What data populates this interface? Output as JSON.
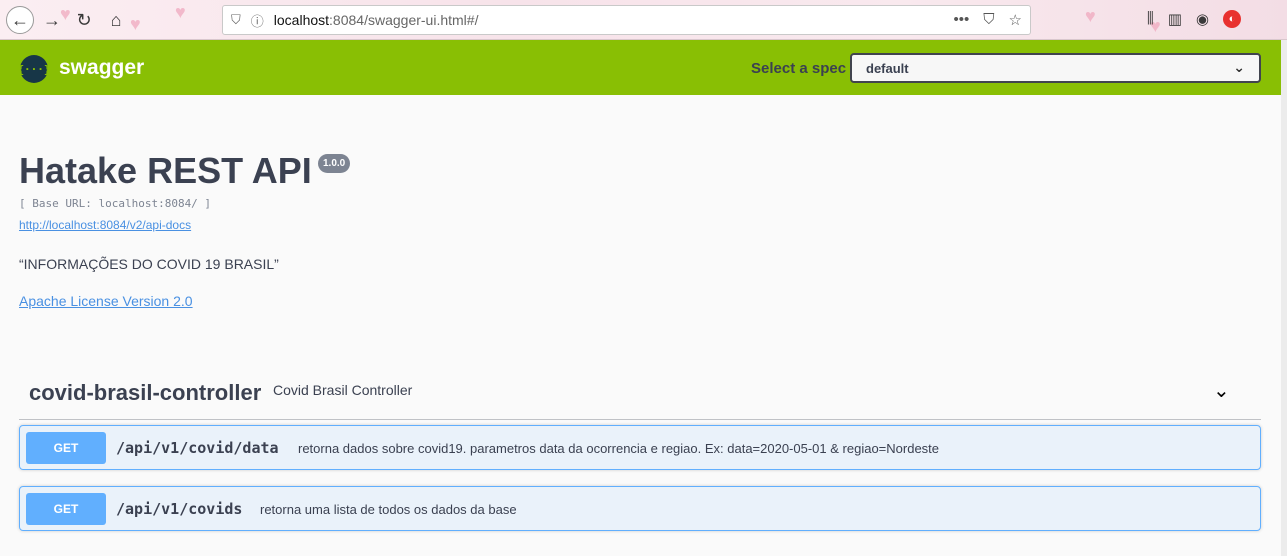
{
  "browser": {
    "url_host": "localhost",
    "url_path": ":8084/swagger-ui.html#/",
    "page_actions_icon": "•••"
  },
  "swagger": {
    "logo_icon": "{···}",
    "logo_text": "swagger",
    "spec_label": "Select a spec",
    "spec_selected": "default"
  },
  "info": {
    "title": "Hatake REST API",
    "version": "1.0.0",
    "base_url": "[ Base URL: localhost:8084/ ]",
    "docs_link": "http://localhost:8084/v2/api-docs",
    "description": "“INFORMAÇÕES DO COVID 19 BRASIL”",
    "license": "Apache License Version 2.0"
  },
  "tag": {
    "name": "covid-brasil-controller",
    "description": "Covid Brasil Controller"
  },
  "operations": [
    {
      "method": "GET",
      "path": "/api/v1/covid/data",
      "summary": "retorna dados sobre covid19. parametros data da ocorrencia e regiao. Ex: data=2020-05-01 & regiao=Nordeste"
    },
    {
      "method": "GET",
      "path": "/api/v1/covids",
      "summary": "retorna uma lista de todos os dados da base"
    }
  ],
  "colors": {
    "topbar": "#89bf04",
    "get_method": "#61affe",
    "link": "#4990e2"
  }
}
